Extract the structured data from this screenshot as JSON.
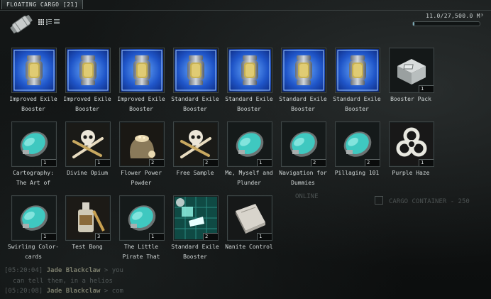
{
  "window": {
    "title": "FLOATING CARGO [21]",
    "capacity": "11.0/27,500.0 M³",
    "capacity_fraction": 0.0004,
    "view_modes": [
      "icons-view",
      "details-view",
      "list-view"
    ]
  },
  "background": {
    "overlay_labels": [
      "ONLINE",
      "CARGO CONTAINER - 250"
    ],
    "chat": [
      {
        "time": "[05:20:04]",
        "name": "Jade Blackclaw",
        "text": " > you"
      },
      {
        "time": "",
        "name": "",
        "text": "can tell them, in a helios"
      },
      {
        "time": "[05:20:08]",
        "name": "Jade Blackclaw",
        "text": " > com"
      }
    ]
  },
  "items": [
    {
      "label": "Improved Exile Booster",
      "qty": "",
      "icon": "booster-capsule-icon"
    },
    {
      "label": "Improved Exile Booster",
      "qty": "",
      "icon": "booster-capsule-icon"
    },
    {
      "label": "Improved Exile Booster",
      "qty": "",
      "icon": "booster-capsule-icon"
    },
    {
      "label": "Standard Exile Booster",
      "qty": "",
      "icon": "booster-capsule-icon"
    },
    {
      "label": "Standard Exile Booster",
      "qty": "",
      "icon": "booster-capsule-icon"
    },
    {
      "label": "Standard Exile Booster",
      "qty": "",
      "icon": "booster-capsule-icon"
    },
    {
      "label": "Standard Exile Booster",
      "qty": "",
      "icon": "booster-capsule-icon"
    },
    {
      "label": "Booster Pack",
      "qty": "1",
      "icon": "crate-icon"
    },
    {
      "label": "Cartography: The Art of",
      "qty": "1",
      "icon": "datacore-disc-icon"
    },
    {
      "label": "Divine Opium",
      "qty": "1",
      "icon": "skull-crossbones-icon"
    },
    {
      "label": "Flower Power Powder",
      "qty": "2",
      "icon": "powder-sack-icon"
    },
    {
      "label": "Free Sample",
      "qty": "2",
      "icon": "skull-crossbones-icon"
    },
    {
      "label": "Me, Myself and Plunder",
      "qty": "1",
      "icon": "datacore-disc-icon"
    },
    {
      "label": "Navigation for Dummies",
      "qty": "2",
      "icon": "datacore-disc-icon"
    },
    {
      "label": "Pillaging 101",
      "qty": "2",
      "icon": "datacore-disc-icon"
    },
    {
      "label": "Purple Haze",
      "qty": "1",
      "icon": "biohazard-icon"
    },
    {
      "label": "Swirling Color-cards",
      "qty": "1",
      "icon": "datacore-disc-icon"
    },
    {
      "label": "Test Bong",
      "qty": "3",
      "icon": "bottle-icon"
    },
    {
      "label": "The Little Pirate That",
      "qty": "1",
      "icon": "datacore-disc-icon"
    },
    {
      "label": "Standard Exile Booster",
      "qty": "2",
      "icon": "blueprint-icon"
    },
    {
      "label": "Nanite Control",
      "qty": "1",
      "icon": "book-icon"
    }
  ],
  "colors": {
    "booster_blue": "#2a67e0",
    "disc_teal": "#3fc8c0",
    "capacity_fill": "#a6d4e0"
  }
}
